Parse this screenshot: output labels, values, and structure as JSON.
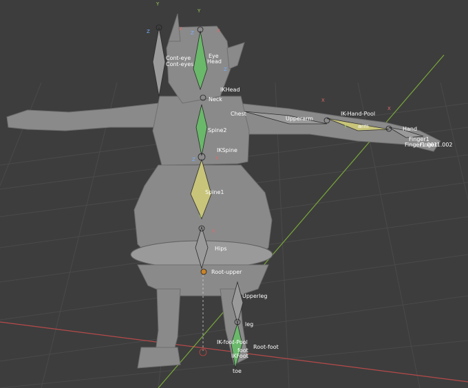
{
  "scene": {
    "colors": {
      "background": "#3d3d3d",
      "grid": "#4a4a4a",
      "x_axis": "#b84a4a",
      "y_axis": "#7aa83a",
      "mesh": "#8a8a8a",
      "bone_yellow": "#c8c47a",
      "bone_green": "#6ab86a",
      "bone_gray": "#9a9a9a"
    }
  },
  "bones": {
    "cont_eye": "Cont-eye",
    "cont_eyes": "Cont-eyes",
    "eye": "Eye",
    "head": "Head",
    "ik_head": "IKHead",
    "neck": "Neck",
    "chest": "Chest",
    "spine2": "Spine2",
    "ik_spine": "IKSpine",
    "spine1": "Spine1",
    "hips": "Hips",
    "root_upper": "Root-upper",
    "upperarm": "Upperarm",
    "arm": "arm",
    "ik_hand_pool": "IK-Hand-Pool",
    "hand": "Hand",
    "finger1": "Finger1",
    "finger1_001": "Finger1.001",
    "finger1_002": "Finger1.002",
    "upperleg": "Upperleg",
    "leg": "leg",
    "ik_foot_pool": "IK-foot-Pool",
    "foot": "foot",
    "ik_foot": "IKFoot",
    "root_foot": "Root-foot",
    "toe": "toe"
  },
  "axis_letters": {
    "x": "X",
    "y": "Y",
    "z": "Z"
  }
}
